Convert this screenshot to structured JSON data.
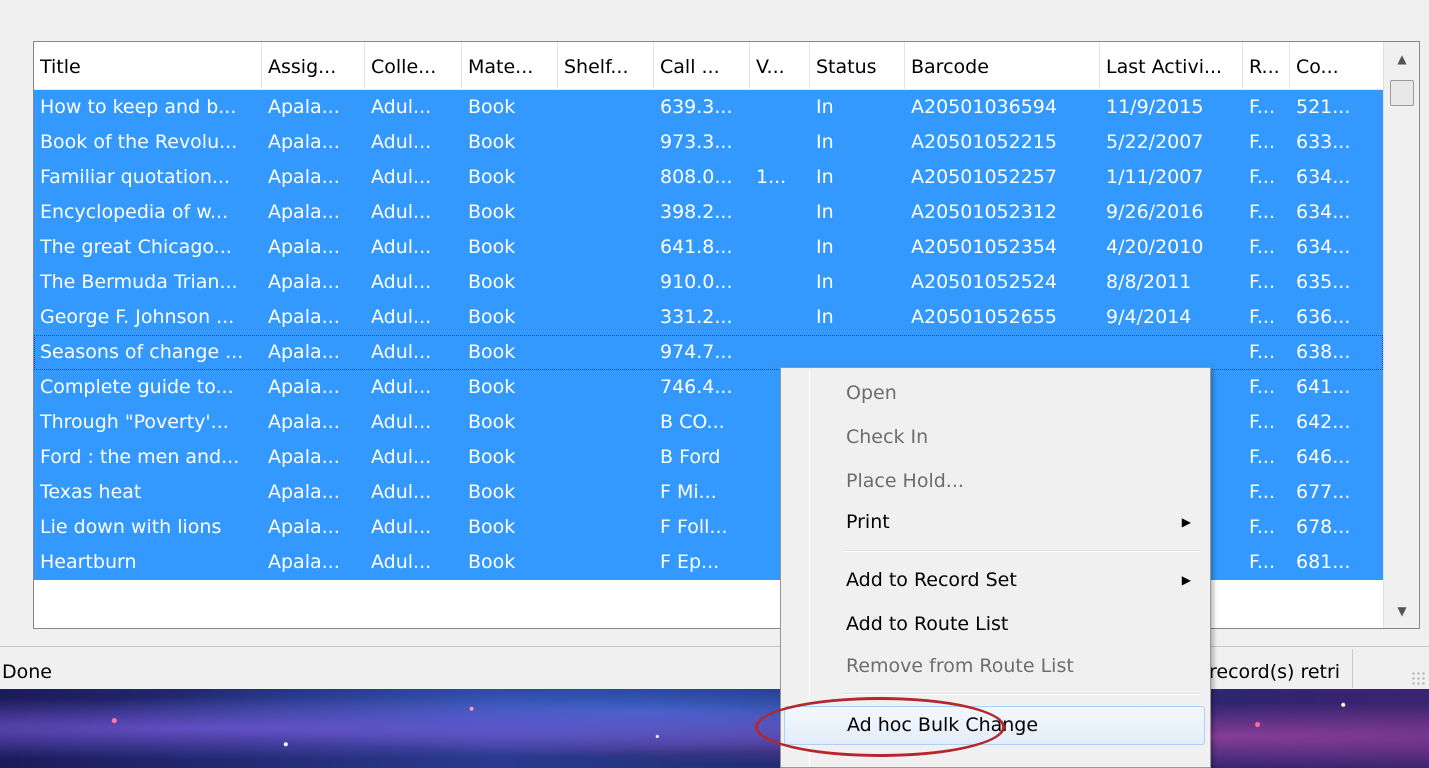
{
  "columns": [
    "Title",
    "Assig...",
    "Colle...",
    "Mate...",
    "Shelf...",
    "Call ...",
    "V...",
    "Status",
    "Barcode",
    "Last Activi...",
    "R...",
    "Co..."
  ],
  "rows": [
    [
      "How to keep and b...",
      "Apala...",
      "Adul...",
      "Book",
      "",
      "639.3...",
      "",
      "In",
      "A20501036594",
      "11/9/2015",
      "F...",
      "521..."
    ],
    [
      "Book of the Revolu...",
      "Apala...",
      "Adul...",
      "Book",
      "",
      "973.3...",
      "",
      "In",
      "A20501052215",
      "5/22/2007",
      "F...",
      "633..."
    ],
    [
      "Familiar quotation...",
      "Apala...",
      "Adul...",
      "Book",
      "",
      "808.0...",
      "1...",
      "In",
      "A20501052257",
      "1/11/2007",
      "F...",
      "634..."
    ],
    [
      "Encyclopedia of w...",
      "Apala...",
      "Adul...",
      "Book",
      "",
      "398.2...",
      "",
      "In",
      "A20501052312",
      "9/26/2016",
      "F...",
      "634..."
    ],
    [
      "The great Chicago...",
      "Apala...",
      "Adul...",
      "Book",
      "",
      "641.8...",
      "",
      "In",
      "A20501052354",
      "4/20/2010",
      "F...",
      "634..."
    ],
    [
      "The Bermuda Trian...",
      "Apala...",
      "Adul...",
      "Book",
      "",
      "910.0...",
      "",
      "In",
      "A20501052524",
      "8/8/2011",
      "F...",
      "635..."
    ],
    [
      "George F. Johnson ...",
      "Apala...",
      "Adul...",
      "Book",
      "",
      "331.2...",
      "",
      "In",
      "A20501052655",
      "9/4/2014",
      "F...",
      "636..."
    ],
    [
      "Seasons of change ...",
      "Apala...",
      "Adul...",
      "Book",
      "",
      "974.7...",
      "",
      "",
      "",
      "",
      "F...",
      "638..."
    ],
    [
      "Complete guide to...",
      "Apala...",
      "Adul...",
      "Book",
      "",
      "746.4...",
      "",
      "",
      "",
      "",
      "F...",
      "641..."
    ],
    [
      "Through \"Poverty'...",
      "Apala...",
      "Adul...",
      "Book",
      "",
      "B CO...",
      "",
      "",
      "",
      "",
      "F...",
      "642..."
    ],
    [
      "Ford : the men and...",
      "Apala...",
      "Adul...",
      "Book",
      "",
      "B Ford",
      "",
      "",
      "",
      "",
      "F...",
      "646..."
    ],
    [
      "Texas heat",
      "Apala...",
      "Adul...",
      "Book",
      "",
      "F Mi...",
      "",
      "",
      "",
      "",
      "F...",
      "677..."
    ],
    [
      "Lie down with lions",
      "Apala...",
      "Adul...",
      "Book",
      "",
      "F Foll...",
      "",
      "",
      "",
      "",
      "F...",
      "678..."
    ],
    [
      "Heartburn",
      "Apala...",
      "Adul...",
      "Book",
      "",
      "F Ep...",
      "",
      "",
      "",
      "",
      "F...",
      "681..."
    ]
  ],
  "status": {
    "text": "Done",
    "records": "record(s) retri"
  },
  "context_menu": {
    "open": "Open",
    "check_in": "Check In",
    "place_hold": "Place Hold...",
    "print": "Print",
    "add_record_set": "Add to Record Set",
    "add_route_list": "Add to Route List",
    "remove_route_list": "Remove from Route List",
    "bulk_change": "Ad hoc Bulk Change"
  },
  "colors": {
    "selection": "#3399ff",
    "highlight_ring": "#b3272d"
  },
  "icons": {
    "scroll_up": "scroll-up-arrow-icon",
    "scroll_down": "scroll-down-arrow-icon",
    "submenu": "submenu-arrow-icon"
  }
}
